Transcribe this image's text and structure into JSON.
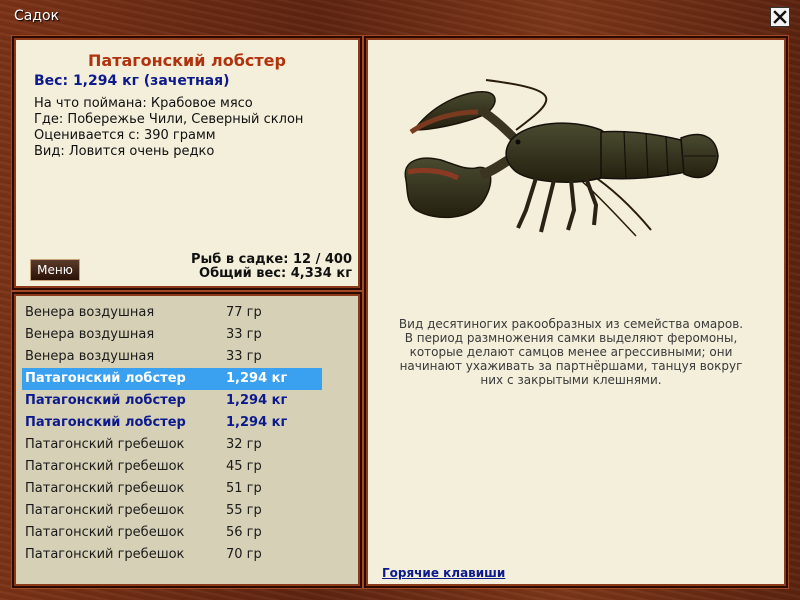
{
  "window": {
    "title": "Садок"
  },
  "fish": {
    "name": "Патагонский лобстер",
    "weight_line": "Вес: 1,294 кг (зачетная)",
    "caught_on": "На что поймана: Крабовое мясо",
    "location": "Где: Побережье Чили, Северный склон",
    "valued_from": "Оценивается с: 390 грамм",
    "rarity": "Вид: Ловится очень редко"
  },
  "menu_button": {
    "label": "Меню"
  },
  "keep_net": {
    "count": "Рыб в садке: 12 / 400",
    "total_weight": "Общий вес: 4,334 кг"
  },
  "catch_list": [
    {
      "name": "Венера воздушная",
      "weight": "77 гр",
      "style": "normal"
    },
    {
      "name": "Венера воздушная",
      "weight": "33 гр",
      "style": "normal"
    },
    {
      "name": "Венера воздушная",
      "weight": "33 гр",
      "style": "normal"
    },
    {
      "name": "Патагонский лобстер",
      "weight": "1,294 кг",
      "style": "selected"
    },
    {
      "name": "Патагонский лобстер",
      "weight": "1,294 кг",
      "style": "bold"
    },
    {
      "name": "Патагонский лобстер",
      "weight": "1,294 кг",
      "style": "bold"
    },
    {
      "name": "Патагонский гребешок",
      "weight": "32 гр",
      "style": "normal"
    },
    {
      "name": "Патагонский гребешок",
      "weight": "45 гр",
      "style": "normal"
    },
    {
      "name": "Патагонский гребешок",
      "weight": "51 гр",
      "style": "normal"
    },
    {
      "name": "Патагонский гребешок",
      "weight": "55 гр",
      "style": "normal"
    },
    {
      "name": "Патагонский гребешок",
      "weight": "56 гр",
      "style": "normal"
    },
    {
      "name": "Патагонский гребешок",
      "weight": "70 гр",
      "style": "normal"
    }
  ],
  "description": {
    "line1": "Вид десятиногих ракообразных из семейства омаров.",
    "line2": "В период размножения самки выделяют феромоны,",
    "line3": "которые делают самцов менее агрессивными; они",
    "line4": "начинают ухаживать за партнёршами, танцуя вокруг",
    "line5": "них с закрытыми клешнями."
  },
  "hotkeys_link": "Горячие клавиши",
  "colors": {
    "title_red": "#b0330d",
    "accent_blue": "#0c1a8c",
    "selection": "#3aa0f0",
    "panel_bg": "#f3efdb",
    "list_bg": "#d6d1b6",
    "frame_wood": "#6b2a12"
  },
  "icons": {
    "close": "close-icon",
    "image": "lobster-image"
  }
}
